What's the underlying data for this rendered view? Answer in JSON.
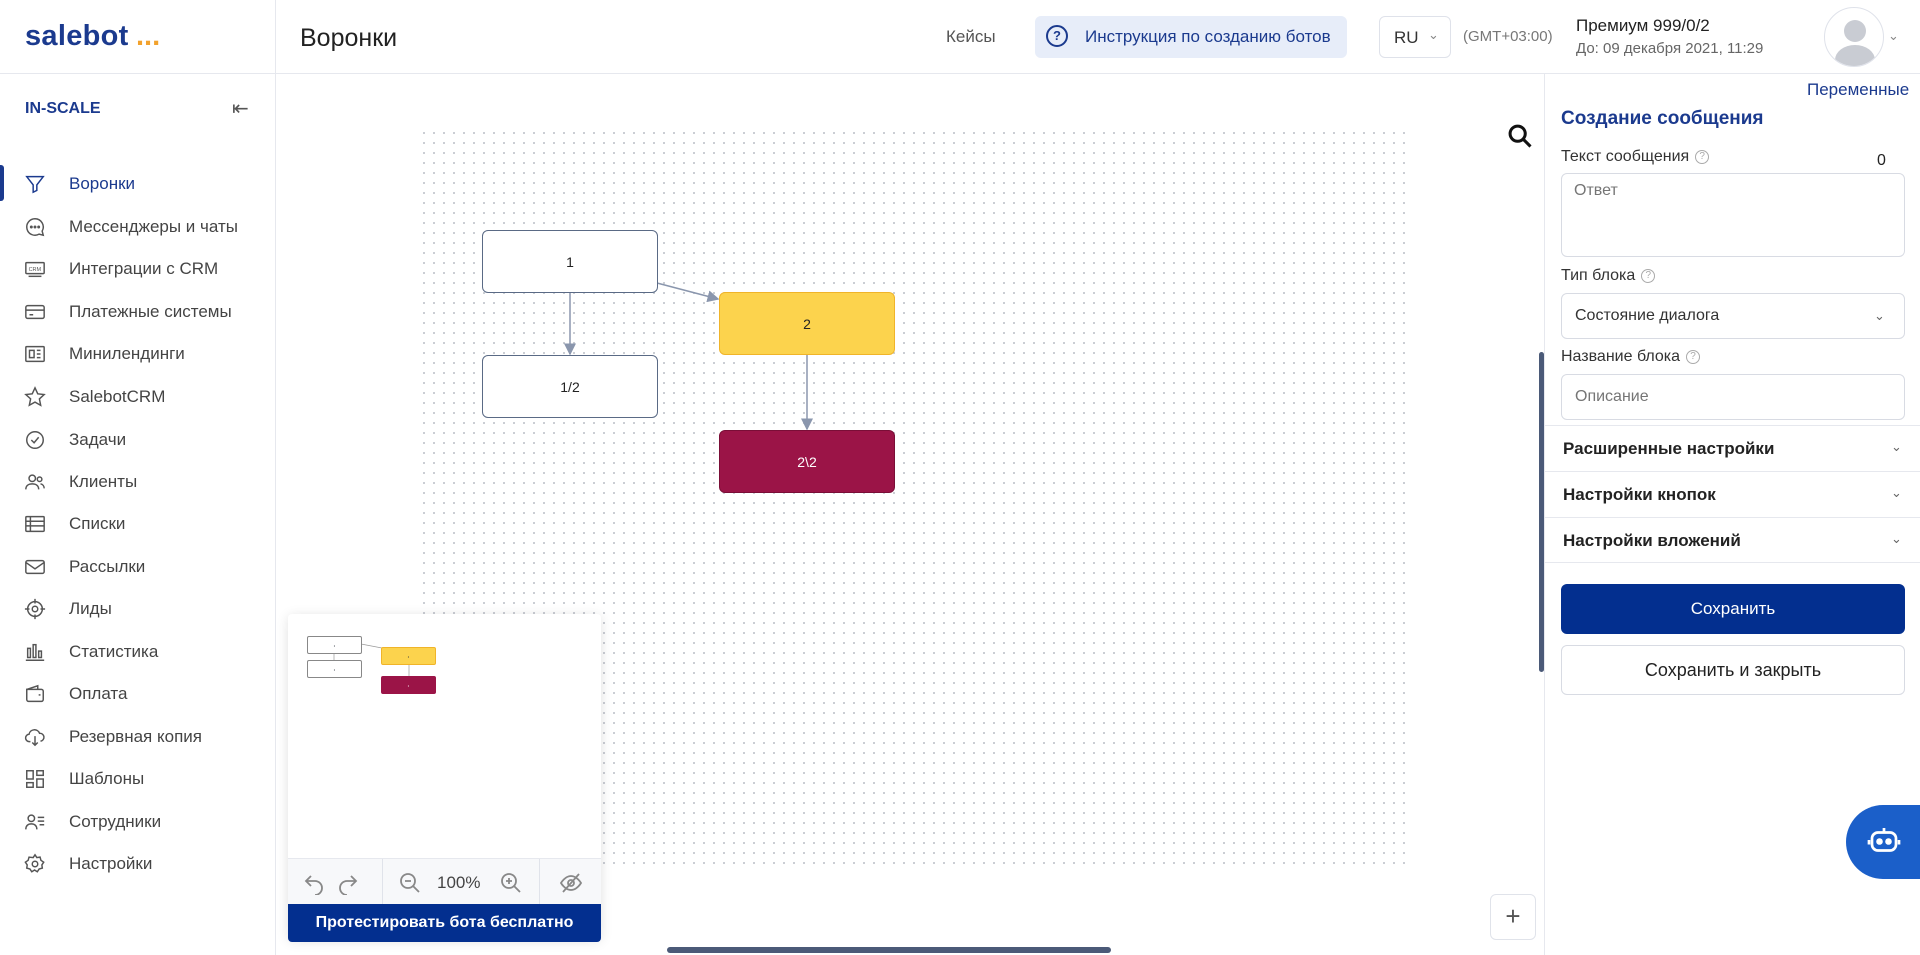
{
  "header": {
    "logo": "salebot",
    "logo_dots": "...",
    "title": "Воронки",
    "cases": "Кейсы",
    "instruction": "Инструкция по созданию ботов",
    "lang": "RU",
    "timezone": "(GMT+03:00)",
    "plan": "Премиум 999/0/2",
    "until": "До: 09 декабря 2021, 11:29"
  },
  "sidebar": {
    "org": "IN-SCALE",
    "items": [
      {
        "label": "Воронки",
        "icon": "funnel-icon"
      },
      {
        "label": "Мессенджеры и чаты",
        "icon": "chat-icon"
      },
      {
        "label": "Интеграции с CRM",
        "icon": "crm-icon"
      },
      {
        "label": "Платежные системы",
        "icon": "card-icon"
      },
      {
        "label": "Минилендинги",
        "icon": "landing-icon"
      },
      {
        "label": "SalebotCRM",
        "icon": "star-icon"
      },
      {
        "label": "Задачи",
        "icon": "check-icon"
      },
      {
        "label": "Клиенты",
        "icon": "users-icon"
      },
      {
        "label": "Списки",
        "icon": "list-icon"
      },
      {
        "label": "Рассылки",
        "icon": "mail-icon"
      },
      {
        "label": "Лиды",
        "icon": "target-icon"
      },
      {
        "label": "Статистика",
        "icon": "chart-icon"
      },
      {
        "label": "Оплата",
        "icon": "wallet-icon"
      },
      {
        "label": "Резервная копия",
        "icon": "backup-icon"
      },
      {
        "label": "Шаблоны",
        "icon": "templates-icon"
      },
      {
        "label": "Сотрудники",
        "icon": "staff-icon"
      },
      {
        "label": "Настройки",
        "icon": "gear-icon"
      }
    ]
  },
  "canvas": {
    "nodes": [
      {
        "label": "1",
        "style": "white"
      },
      {
        "label": "2",
        "style": "yellow"
      },
      {
        "label": "1/2",
        "style": "white"
      },
      {
        "label": "2\\2",
        "style": "red"
      }
    ],
    "zoom": "100%",
    "test_bot": "Протестировать бота бесплатно",
    "colors": {
      "yellow": "#fcd34d",
      "red": "#9b1447",
      "primary": "#032f8f"
    }
  },
  "panel": {
    "variables": "Переменные",
    "title": "Создание сообщения",
    "text_label": "Текст сообщения",
    "text_counter": "0",
    "text_placeholder": "Ответ",
    "block_type_label": "Тип блока",
    "block_type_value": "Состояние диалога",
    "block_name_label": "Название блока",
    "block_name_placeholder": "Описание",
    "sections": [
      "Расширенные настройки",
      "Настройки кнопок",
      "Настройки вложений"
    ],
    "save": "Сохранить",
    "save_close": "Сохранить и закрыть"
  }
}
